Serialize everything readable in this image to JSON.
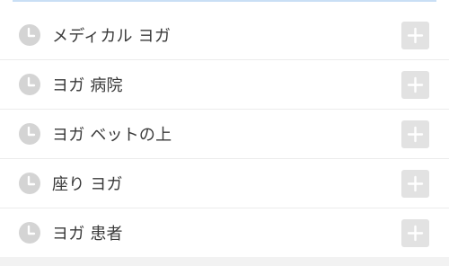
{
  "search_history": {
    "items": [
      {
        "label": "メディカル ヨガ",
        "icon": "clock-icon",
        "action_icon": "plus-icon"
      },
      {
        "label": "ヨガ 病院",
        "icon": "clock-icon",
        "action_icon": "plus-icon"
      },
      {
        "label": "ヨガ ベットの上",
        "icon": "clock-icon",
        "action_icon": "plus-icon"
      },
      {
        "label": "座り ヨガ",
        "icon": "clock-icon",
        "action_icon": "plus-icon"
      },
      {
        "label": "ヨガ 患者",
        "icon": "clock-icon",
        "action_icon": "plus-icon"
      }
    ]
  },
  "colors": {
    "icon_gray": "#d4d4d4",
    "add_button_bg": "#e2e2e2",
    "text": "#3a3a3a",
    "search_border": "#c9dff5"
  }
}
